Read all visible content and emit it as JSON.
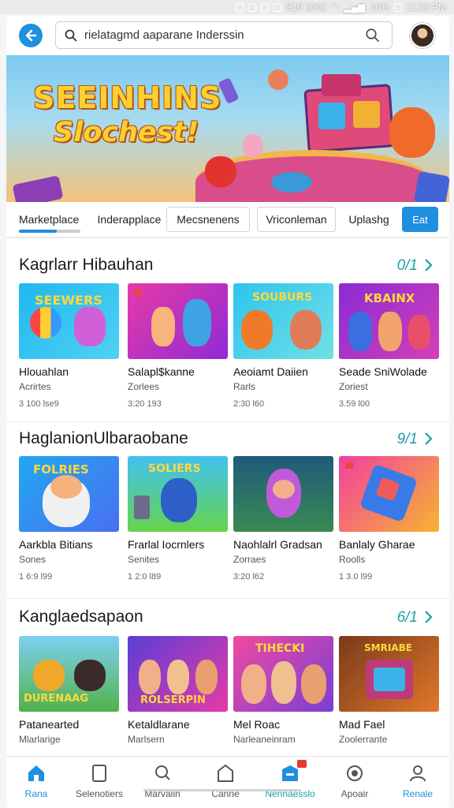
{
  "status_bar": {
    "left_text": "S10 2602",
    "battery": "16%",
    "time": "11:33 PM"
  },
  "search": {
    "value": "rielatagmd aaparane Inderssin"
  },
  "banner": {
    "title_line1": "SEEINHINS",
    "title_line2": "Slochest!"
  },
  "tabs": [
    {
      "label": "Marketplace"
    },
    {
      "label": "Inderapplace"
    },
    {
      "label": "Mecsnenens"
    },
    {
      "label": "Vriconleman"
    },
    {
      "label": "Uplashg"
    },
    {
      "label": "Eat"
    }
  ],
  "sections": [
    {
      "title": "Kagrlarr Hibauhan",
      "count": "0/1",
      "cards": [
        {
          "name": "Hlouahlan",
          "sub": "Acrirtes",
          "meta": "3 100 lse9"
        },
        {
          "name": "Salapl$kanne",
          "sub": "Zorlees",
          "meta": "3:20 193"
        },
        {
          "name": "Aeoiamt Daiien",
          "sub": "Rarls",
          "meta": "2:30 l60"
        },
        {
          "name": "Seade SniWolade",
          "sub": "Zoriest",
          "meta": "3.59 l00"
        }
      ]
    },
    {
      "title": "HaglanionUlbaraobane",
      "count": "9/1",
      "cards": [
        {
          "name": "Aarkbla Bitians",
          "sub": "Sones",
          "meta": "1 6:9 l99"
        },
        {
          "name": "Frarlal Iocrnlers",
          "sub": "Senites",
          "meta": "1 2:0 l89"
        },
        {
          "name": "Naohlalrl Gradsan",
          "sub": "Zorraes",
          "meta": "3:20 l62"
        },
        {
          "name": "Banlaly Gharae",
          "sub": "Roolls",
          "meta": "1 3.0 l99"
        }
      ]
    },
    {
      "title": "Kanglaedsapaon",
      "count": "6/1",
      "cards": [
        {
          "name": "Patanearted",
          "sub": "Mlarlarige",
          "meta": ""
        },
        {
          "name": "Ketaldlarane",
          "sub": "Marlsern",
          "meta": ""
        },
        {
          "name": "Mel Roac",
          "sub": "Narleaneinram",
          "meta": ""
        },
        {
          "name": "Mad Fael",
          "sub": "Zoolerrante",
          "meta": ""
        }
      ]
    }
  ],
  "bottom_nav": [
    {
      "label": "Rana",
      "icon": "home-icon"
    },
    {
      "label": "Selenotiers",
      "icon": "tablet-icon"
    },
    {
      "label": "Marvalin",
      "icon": "search-icon"
    },
    {
      "label": "Canne",
      "icon": "store-icon"
    },
    {
      "label": "Nennaesslo",
      "icon": "inbox-icon"
    },
    {
      "label": "Apoair",
      "icon": "globe-icon"
    },
    {
      "label": "Renale",
      "icon": "profile-icon"
    }
  ],
  "colors": {
    "accent": "#1f8fe0",
    "teal": "#1aa0a8",
    "banner_title": "#ffcf2e"
  }
}
